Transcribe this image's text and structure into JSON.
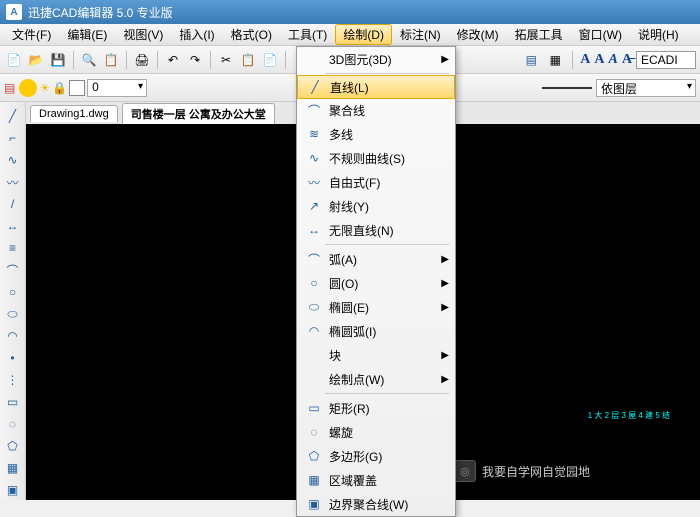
{
  "title": "迅捷CAD编辑器 5.0 专业版",
  "menubar": [
    "文件(F)",
    "编辑(E)",
    "视图(V)",
    "插入(I)",
    "格式(O)",
    "工具(T)",
    "绘制(D)",
    "标注(N)",
    "修改(M)",
    "拓展工具",
    "窗口(W)",
    "说明(H)"
  ],
  "active_menu_index": 6,
  "layer_combo": "0",
  "right_combo": "ECADI",
  "layer_label": "依图层",
  "tabs": [
    "Drawing1.dwg",
    "司售楼一层 公寓及办公大堂"
  ],
  "draw_menu": {
    "top": "3D图元(3D)",
    "items": [
      {
        "icon": "╱",
        "label": "直线(L)",
        "hl": true
      },
      {
        "icon": "⌒",
        "label": "聚合线"
      },
      {
        "icon": "≋",
        "label": "多线"
      },
      {
        "icon": "∿",
        "label": "不规则曲线(S)"
      },
      {
        "icon": "〰",
        "label": "自由式(F)"
      },
      {
        "icon": "↗",
        "label": "射线(Y)"
      },
      {
        "icon": "↔",
        "label": "无限直线(N)"
      }
    ],
    "sub1": [
      {
        "label": "弧(A)",
        "sub": true
      },
      {
        "label": "圆(O)",
        "sub": true
      },
      {
        "label": "椭圆(E)",
        "sub": true
      },
      {
        "label": "椭圆弧(I)"
      },
      {
        "label": "块",
        "sub": true
      },
      {
        "label": "绘制点(W)",
        "sub": true
      }
    ],
    "sub2": [
      {
        "icon": "▭",
        "label": "矩形(R)"
      },
      {
        "icon": "◌",
        "label": "螺旋"
      },
      {
        "icon": "⬠",
        "label": "多边形(G)"
      },
      {
        "icon": "▦",
        "label": "区域覆盖"
      },
      {
        "icon": "▣",
        "label": "边界聚合线(W)"
      }
    ]
  },
  "watermark": "我要自学网自觉园地",
  "cyan": "1 大\n2 层\n3 屋\n4 建\n5 结"
}
